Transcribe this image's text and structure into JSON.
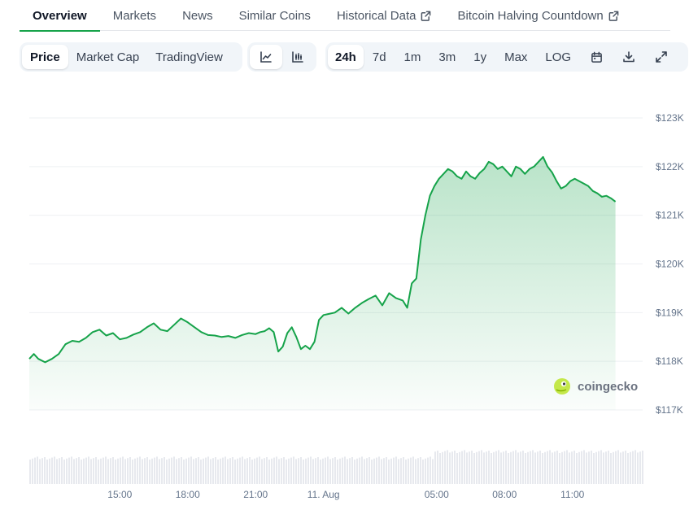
{
  "tabs": [
    {
      "label": "Overview",
      "active": true
    },
    {
      "label": "Markets"
    },
    {
      "label": "News"
    },
    {
      "label": "Similar Coins"
    },
    {
      "label": "Historical Data",
      "external": true
    },
    {
      "label": "Bitcoin Halving Countdown",
      "external": true
    }
  ],
  "toolbar": {
    "views": [
      "Price",
      "Market Cap",
      "TradingView"
    ],
    "active_view": "Price",
    "chart_style_icons": [
      "line-chart-icon",
      "candlestick-icon"
    ],
    "ranges": [
      "24h",
      "7d",
      "1m",
      "3m",
      "1y",
      "Max",
      "LOG"
    ],
    "active_range": "24h",
    "action_icons": [
      "calendar-icon",
      "download-icon",
      "fullscreen-icon"
    ]
  },
  "watermark": "coingecko",
  "colors": {
    "line": "#16a34a",
    "accent": "#16a34a"
  },
  "chart_data": {
    "type": "area",
    "x_tick_labels": [
      "15:00",
      "18:00",
      "21:00",
      "11. Aug",
      "05:00",
      "08:00",
      "11:00"
    ],
    "x_tick_hours": [
      3.3,
      6.3,
      9.3,
      12.3,
      17.3,
      20.3,
      23.3
    ],
    "y_tick_labels": [
      "$117K",
      "$118K",
      "$119K",
      "$120K",
      "$121K",
      "$122K",
      "$123K"
    ],
    "y_tick_values": [
      117000,
      118000,
      119000,
      120000,
      121000,
      122000,
      123000
    ],
    "ylim": [
      117000,
      123000
    ],
    "x_range_hours": [
      -0.7,
      26.4
    ],
    "grid": true,
    "series": [
      {
        "x": [
          -0.7,
          -0.5,
          -0.3,
          0.0,
          0.3,
          0.6,
          0.9,
          1.2,
          1.5,
          1.8,
          2.1,
          2.4,
          2.7,
          3.0,
          3.3,
          3.6,
          3.9,
          4.2,
          4.5,
          4.8,
          5.1,
          5.4,
          5.7,
          6.0,
          6.3,
          6.6,
          6.9,
          7.2,
          7.5,
          7.8,
          8.1,
          8.4,
          8.7,
          9.0,
          9.3,
          9.5,
          9.7,
          9.9,
          10.1,
          10.3,
          10.5,
          10.7,
          10.9,
          11.1,
          11.3,
          11.5,
          11.7,
          11.9,
          12.1,
          12.3,
          12.5,
          12.8,
          13.1,
          13.4,
          13.7,
          14.0,
          14.3,
          14.6,
          14.9,
          15.2,
          15.5,
          15.8,
          16.0,
          16.2,
          16.4,
          16.6,
          16.8,
          17.0,
          17.2,
          17.4,
          17.6,
          17.8,
          18.0,
          18.2,
          18.4,
          18.6,
          18.8,
          19.0,
          19.2,
          19.4,
          19.6,
          19.8,
          20.0,
          20.2,
          20.4,
          20.6,
          20.8,
          21.0,
          21.2,
          21.4,
          21.6,
          21.8,
          22.0,
          22.2,
          22.4,
          22.6,
          22.8,
          23.0,
          23.2,
          23.4,
          23.6,
          23.8,
          24.0,
          24.2,
          24.4,
          24.6,
          24.8,
          25.0,
          25.2
        ],
        "y": [
          118050,
          118150,
          118050,
          117980,
          118050,
          118150,
          118350,
          118420,
          118400,
          118480,
          118600,
          118650,
          118530,
          118580,
          118450,
          118480,
          118550,
          118600,
          118700,
          118780,
          118650,
          118620,
          118750,
          118880,
          118800,
          118700,
          118600,
          118540,
          118530,
          118500,
          118520,
          118480,
          118540,
          118580,
          118560,
          118600,
          118620,
          118680,
          118600,
          118200,
          118300,
          118580,
          118700,
          118500,
          118250,
          118320,
          118250,
          118400,
          118850,
          118950,
          118970,
          119000,
          119100,
          118980,
          119100,
          119200,
          119280,
          119350,
          119150,
          119400,
          119300,
          119250,
          119100,
          119600,
          119700,
          120500,
          121000,
          121400,
          121600,
          121750,
          121850,
          121950,
          121900,
          121800,
          121750,
          121900,
          121800,
          121750,
          121870,
          121950,
          122100,
          122050,
          121950,
          122000,
          121900,
          121800,
          122000,
          121950,
          121850,
          121950,
          122000,
          122100,
          122200,
          122000,
          121880,
          121700,
          121550,
          121600,
          121700,
          121750,
          121700,
          121650,
          121600,
          121500,
          121450,
          121380,
          121400,
          121350,
          121280
        ]
      }
    ]
  }
}
